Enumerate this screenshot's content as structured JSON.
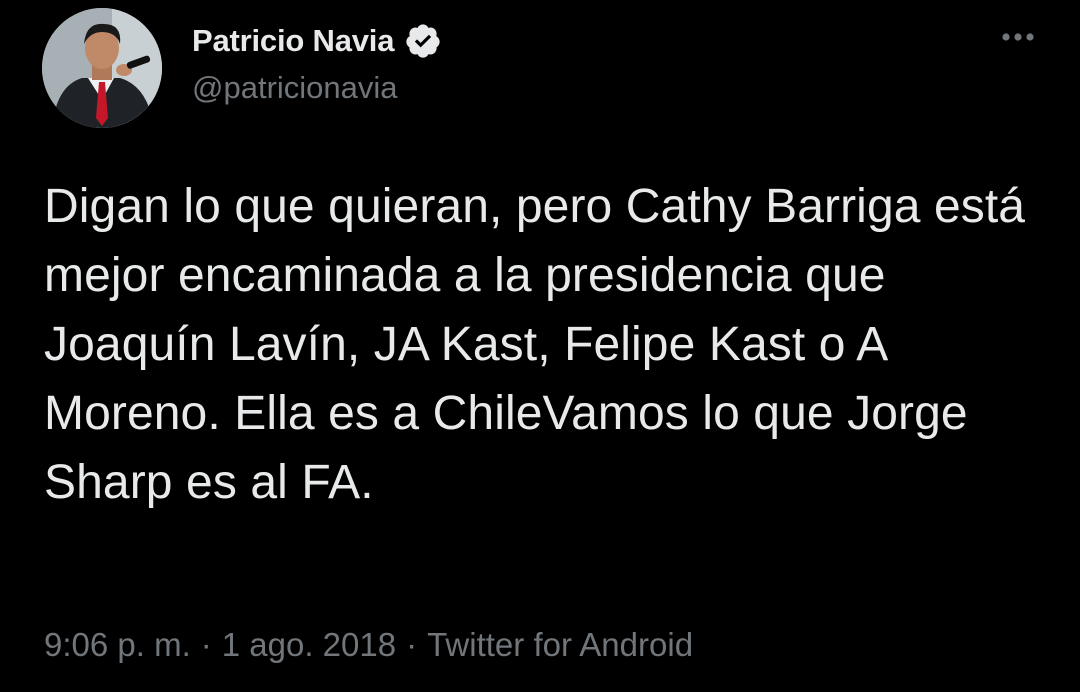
{
  "author": {
    "display_name": "Patricio Navia",
    "handle": "@patricionavia",
    "verified": true
  },
  "tweet": {
    "text": "Digan lo que quieran, pero Cathy Barriga está mejor encaminada a la presidencia que Joaquín Lavín, JA Kast, Felipe Kast o A Moreno. Ella es a ChileVamos lo que Jorge Sharp es al FA."
  },
  "meta": {
    "time": "9:06 p. m.",
    "separator": "·",
    "date": "1 ago. 2018",
    "source": "Twitter for Android"
  },
  "icons": {
    "verified": "verified-badge-icon",
    "more": "more-options-icon"
  },
  "colors": {
    "background": "#000000",
    "primary_text": "#e7e9ea",
    "secondary_text": "#71767b",
    "accent": "#e7e9ea"
  }
}
